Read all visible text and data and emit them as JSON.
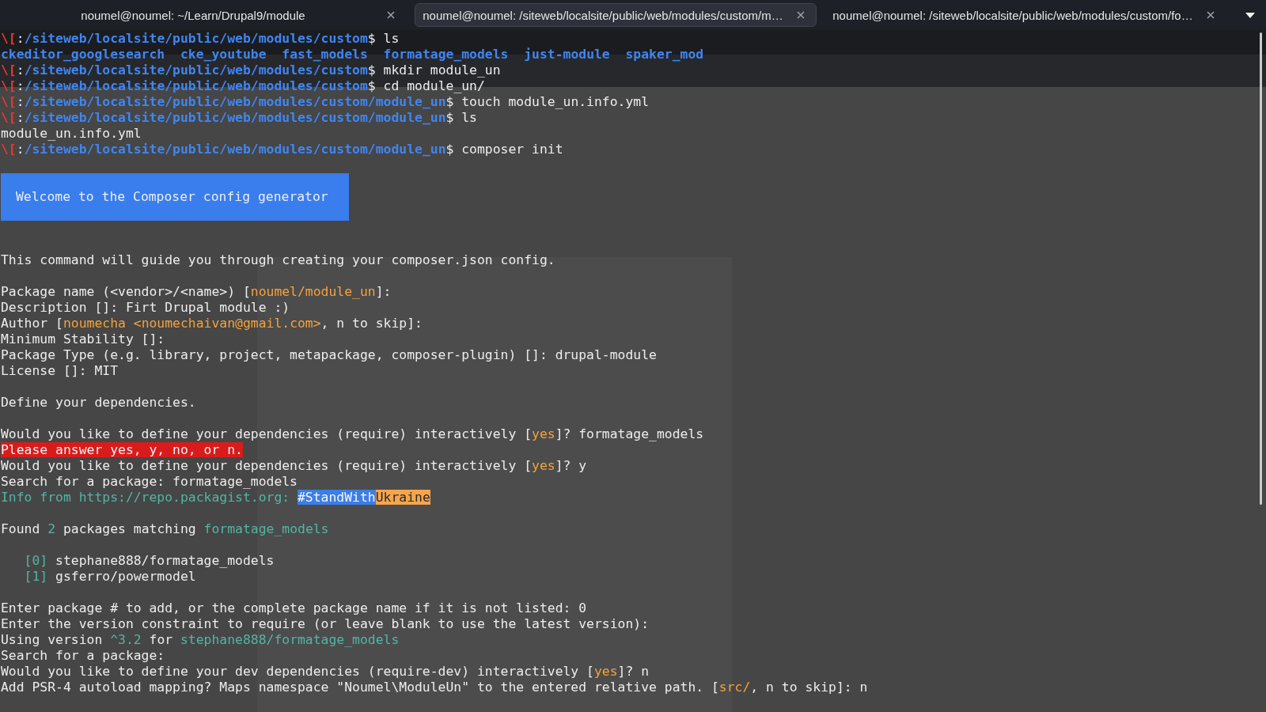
{
  "terminal": {
    "tabs": [
      {
        "title": "noumel@noumel: ~/Learn/Drupal9/module",
        "selected": false
      },
      {
        "title": "noumel@noumel: /siteweb/localsite/public/web/modules/custom/m…",
        "selected": true
      },
      {
        "title": "noumel@noumel: /siteweb/localsite/public/web/modules/custom/fo…",
        "selected": false
      }
    ],
    "lines": [
      {
        "kind": "prompt",
        "segments": [
          {
            "kind": "marker",
            "text": "\\["
          },
          {
            "kind": "plain",
            "text": ":"
          },
          {
            "kind": "path",
            "text": "/siteweb/localsite/public/web/modules/custom"
          },
          {
            "kind": "plain",
            "text": "$ ls"
          }
        ]
      },
      {
        "kind": "listing",
        "entries": [
          "ckeditor_googlesearch",
          "cke_youtube",
          "fast_models",
          "formatage_models",
          "just-module",
          "spaker_mod"
        ]
      },
      {
        "kind": "prompt",
        "segments": [
          {
            "kind": "marker",
            "text": "\\["
          },
          {
            "kind": "plain",
            "text": ":"
          },
          {
            "kind": "path",
            "text": "/siteweb/localsite/public/web/modules/custom"
          },
          {
            "kind": "plain",
            "text": "$ mkdir module_un"
          }
        ]
      },
      {
        "kind": "prompt",
        "segments": [
          {
            "kind": "marker",
            "text": "\\["
          },
          {
            "kind": "plain",
            "text": ":"
          },
          {
            "kind": "path",
            "text": "/siteweb/localsite/public/web/modules/custom"
          },
          {
            "kind": "plain",
            "text": "$ cd module_un/"
          }
        ]
      },
      {
        "kind": "prompt",
        "segments": [
          {
            "kind": "marker",
            "text": "\\["
          },
          {
            "kind": "plain",
            "text": ":"
          },
          {
            "kind": "path",
            "text": "/siteweb/localsite/public/web/modules/custom/module_un"
          },
          {
            "kind": "plain",
            "text": "$ touch module_un.info.yml"
          }
        ]
      },
      {
        "kind": "prompt",
        "segments": [
          {
            "kind": "marker",
            "text": "\\["
          },
          {
            "kind": "plain",
            "text": ":"
          },
          {
            "kind": "path",
            "text": "/siteweb/localsite/public/web/modules/custom/module_un"
          },
          {
            "kind": "plain",
            "text": "$ ls"
          }
        ]
      },
      {
        "kind": "output",
        "segments": [
          {
            "kind": "plain",
            "text": "module_un.info.yml"
          }
        ]
      },
      {
        "kind": "prompt",
        "segments": [
          {
            "kind": "marker",
            "text": "\\["
          },
          {
            "kind": "plain",
            "text": ":"
          },
          {
            "kind": "path",
            "text": "/siteweb/localsite/public/web/modules/custom/module_un"
          },
          {
            "kind": "plain",
            "text": "$ composer init"
          }
        ]
      },
      {
        "kind": "blank"
      },
      {
        "kind": "banner",
        "text": "Welcome to the Composer config generator"
      },
      {
        "kind": "blank"
      },
      {
        "kind": "blank"
      },
      {
        "kind": "output",
        "segments": [
          {
            "kind": "plain",
            "text": "This command will guide you through creating your composer.json config."
          }
        ]
      },
      {
        "kind": "blank"
      },
      {
        "kind": "output",
        "segments": [
          {
            "kind": "plain",
            "text": "Package name (<vendor>/<name>) ["
          },
          {
            "kind": "option",
            "text": "noumel/module_un"
          },
          {
            "kind": "plain",
            "text": "]:"
          }
        ]
      },
      {
        "kind": "output",
        "segments": [
          {
            "kind": "plain",
            "text": "Description []: Firt Drupal module :)"
          }
        ]
      },
      {
        "kind": "output",
        "segments": [
          {
            "kind": "plain",
            "text": "Author ["
          },
          {
            "kind": "option",
            "text": "noumecha <noumechaivan@gmail.com>"
          },
          {
            "kind": "plain",
            "text": ", n to skip]:"
          }
        ]
      },
      {
        "kind": "output",
        "segments": [
          {
            "kind": "plain",
            "text": "Minimum Stability []:"
          }
        ]
      },
      {
        "kind": "output",
        "segments": [
          {
            "kind": "plain",
            "text": "Package Type (e.g. library, project, metapackage, composer-plugin) []: drupal-module"
          }
        ]
      },
      {
        "kind": "output",
        "segments": [
          {
            "kind": "plain",
            "text": "License []: MIT"
          }
        ]
      },
      {
        "kind": "blank"
      },
      {
        "kind": "output",
        "segments": [
          {
            "kind": "plain",
            "text": "Define your dependencies."
          }
        ]
      },
      {
        "kind": "blank"
      },
      {
        "kind": "output",
        "segments": [
          {
            "kind": "plain",
            "text": "Would you like to define your dependencies (require) interactively ["
          },
          {
            "kind": "option",
            "text": "yes"
          },
          {
            "kind": "plain",
            "text": "]? formatage_models"
          }
        ]
      },
      {
        "kind": "output",
        "segments": [
          {
            "kind": "error",
            "text": "Please answer yes, y, no, or n."
          }
        ]
      },
      {
        "kind": "output",
        "segments": [
          {
            "kind": "plain",
            "text": "Would you like to define your dependencies (require) interactively ["
          },
          {
            "kind": "option",
            "text": "yes"
          },
          {
            "kind": "plain",
            "text": "]? y"
          }
        ]
      },
      {
        "kind": "output",
        "segments": [
          {
            "kind": "plain",
            "text": "Search for a package: formatage_models"
          }
        ]
      },
      {
        "kind": "output",
        "segments": [
          {
            "kind": "info",
            "text": "Info from https://repo.packagist.org: "
          },
          {
            "kind": "selection",
            "text": "#StandWith"
          },
          {
            "kind": "warning",
            "text": "Ukraine"
          }
        ]
      },
      {
        "kind": "blank"
      },
      {
        "kind": "output",
        "segments": [
          {
            "kind": "plain",
            "text": "Found "
          },
          {
            "kind": "info",
            "text": "2"
          },
          {
            "kind": "plain",
            "text": " packages matching "
          },
          {
            "kind": "info",
            "text": "formatage_models"
          }
        ]
      },
      {
        "kind": "blank"
      },
      {
        "kind": "indented",
        "segments": [
          {
            "kind": "info",
            "text": "[0]"
          },
          {
            "kind": "plain",
            "text": " stephane888/formatage_models"
          }
        ]
      },
      {
        "kind": "indented",
        "segments": [
          {
            "kind": "info",
            "text": "[1]"
          },
          {
            "kind": "plain",
            "text": " gsferro/powermodel"
          }
        ]
      },
      {
        "kind": "blank"
      },
      {
        "kind": "output",
        "segments": [
          {
            "kind": "plain",
            "text": "Enter package # to add, or the complete package name if it is not listed: 0"
          }
        ]
      },
      {
        "kind": "output",
        "segments": [
          {
            "kind": "plain",
            "text": "Enter the version constraint to require (or leave blank to use the latest version):"
          }
        ]
      },
      {
        "kind": "output",
        "segments": [
          {
            "kind": "plain",
            "text": "Using version "
          },
          {
            "kind": "info",
            "text": "^3.2"
          },
          {
            "kind": "plain",
            "text": " for "
          },
          {
            "kind": "info",
            "text": "stephane888/formatage_models"
          }
        ]
      },
      {
        "kind": "output",
        "segments": [
          {
            "kind": "plain",
            "text": "Search for a package:"
          }
        ]
      },
      {
        "kind": "output",
        "segments": [
          {
            "kind": "plain",
            "text": "Would you like to define your dev dependencies (require-dev) interactively ["
          },
          {
            "kind": "option",
            "text": "yes"
          },
          {
            "kind": "plain",
            "text": "]? n"
          }
        ]
      },
      {
        "kind": "output",
        "segments": [
          {
            "kind": "plain",
            "text": "Add PSR-4 autoload mapping? Maps namespace \"Noumel\\ModuleUn\" to the entered relative path. ["
          },
          {
            "kind": "option",
            "text": "src/"
          },
          {
            "kind": "plain",
            "text": ", n to skip]: n"
          }
        ]
      }
    ]
  }
}
